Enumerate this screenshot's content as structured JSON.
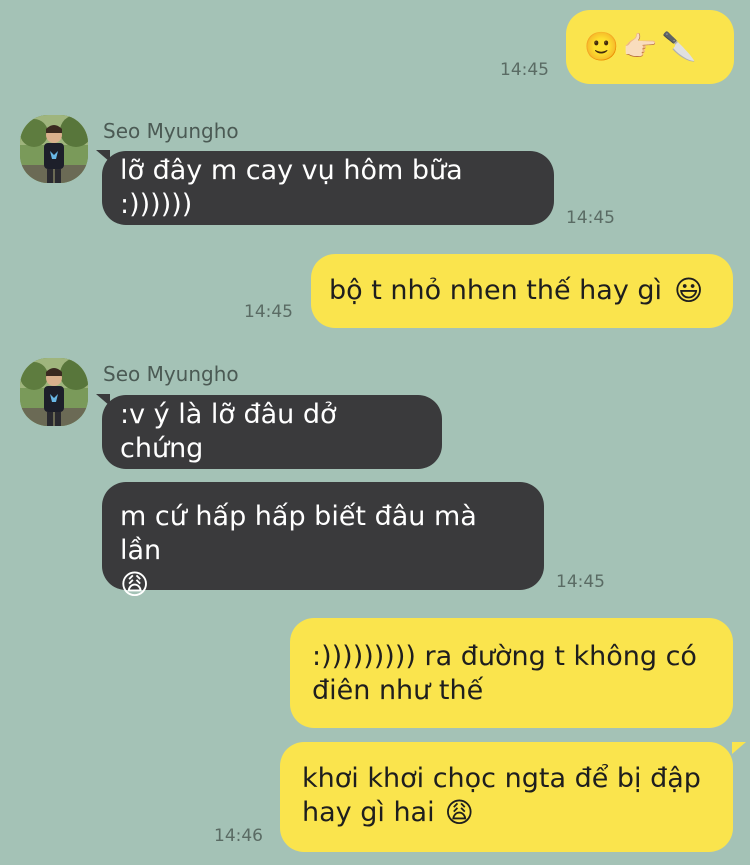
{
  "messages": [
    {
      "side": "me",
      "emojis": [
        "🙂",
        "👉🏻",
        "🔪"
      ],
      "time": "14:45"
    },
    {
      "side": "them",
      "sender": "Seo Myungho",
      "text": "lỡ đây m cay vụ hôm bữa :))))))",
      "time": "14:45"
    },
    {
      "side": "me",
      "text": "bộ t nhỏ nhen thế hay gì",
      "emoji": "😃",
      "time": "14:45"
    },
    {
      "side": "them",
      "sender": "Seo Myungho",
      "text": ":v ý là lỡ đâu dở chứng"
    },
    {
      "side": "them",
      "text_line1": "m cứ hấp hấp biết đâu mà lần",
      "emoji": "😩",
      "time": "14:45"
    },
    {
      "side": "me",
      "text_line1": ":))))))))) ra đường t không có",
      "text_line2": "điên như thế"
    },
    {
      "side": "me",
      "text_line1": "khơi khơi chọc ngta để bị đập",
      "text_line2": "hay gì hai",
      "emoji": "😩",
      "time": "14:46"
    }
  ],
  "colors": {
    "background": "#a4c2b6",
    "my_bubble": "#fae44d",
    "their_bubble": "#3a3a3c"
  }
}
